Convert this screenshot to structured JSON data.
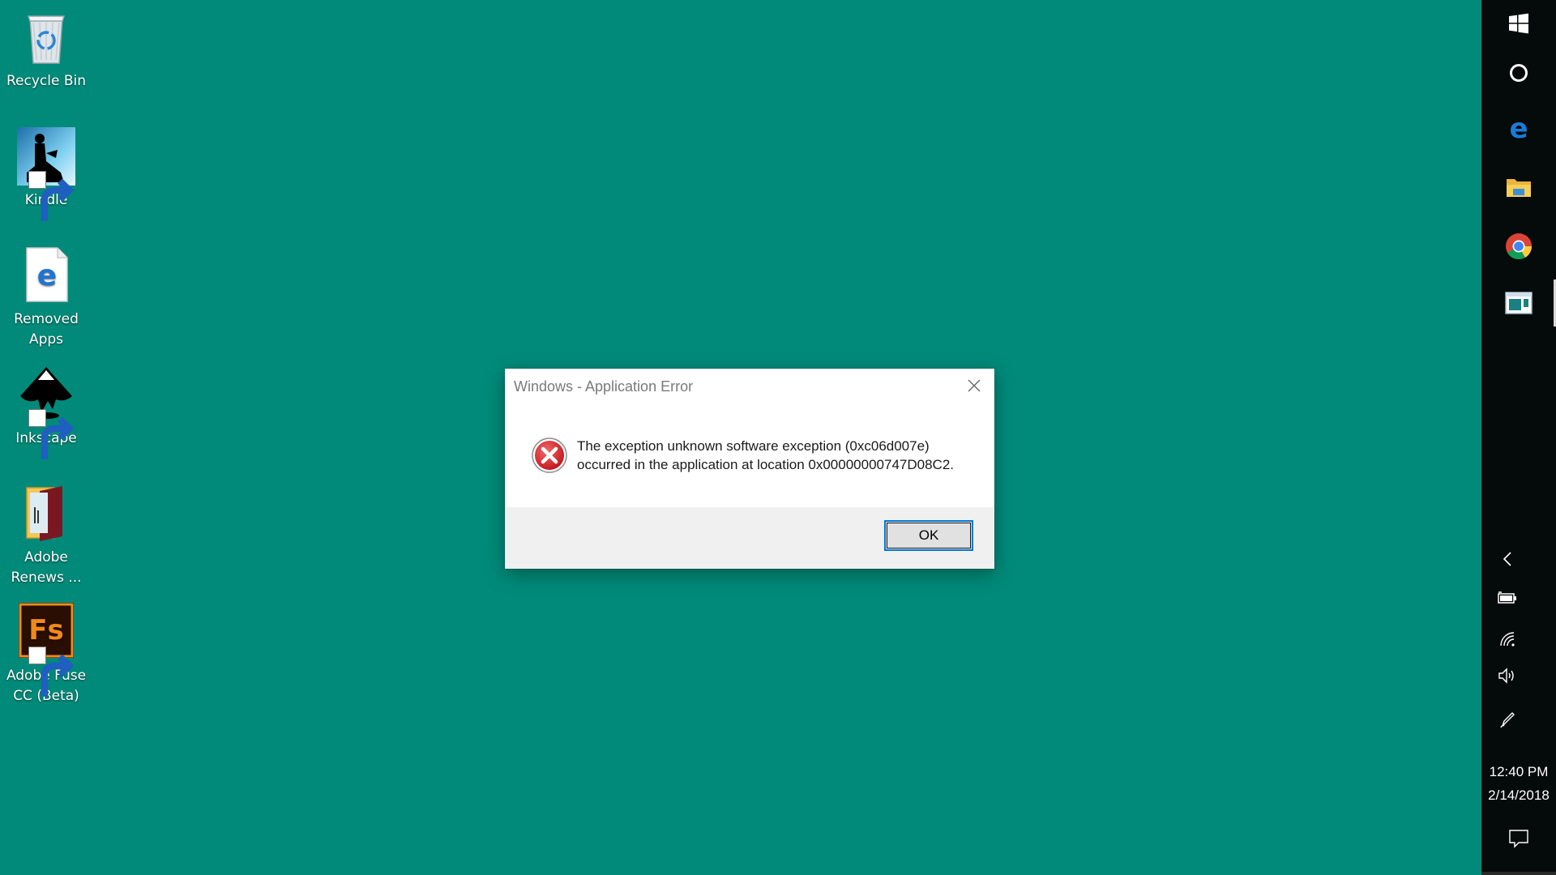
{
  "desktop": {
    "background_color": "#018a79",
    "icons": [
      {
        "id": "recycle-bin",
        "label": "Recycle Bin",
        "icon": "recycle-bin-icon",
        "shortcut": false
      },
      {
        "id": "kindle",
        "label": "Kindle",
        "icon": "kindle-icon",
        "shortcut": true
      },
      {
        "id": "removed-apps",
        "label": "Removed Apps",
        "icon": "edge-document-icon",
        "shortcut": false
      },
      {
        "id": "inkscape",
        "label": "Inkscape",
        "icon": "inkscape-icon",
        "shortcut": true
      },
      {
        "id": "adobe-renews",
        "label": "Adobe Renews ...",
        "icon": "folder-icon",
        "shortcut": false
      },
      {
        "id": "adobe-fuse",
        "label": "Adobe Fuse CC (Beta)",
        "icon": "adobe-fuse-icon",
        "shortcut": true
      }
    ]
  },
  "dialog": {
    "title": "Windows - Application Error",
    "message_line1": "The exception unknown software exception (0xc06d007e)",
    "message_line2": "occurred in the application at location 0x00000000747D08C2.",
    "ok_label": "OK",
    "icon": "error-icon"
  },
  "taskbar": {
    "background_color": "#050a0a",
    "pinned": [
      {
        "id": "start",
        "icon": "windows-start-icon"
      },
      {
        "id": "cortana",
        "icon": "cortana-circle-icon"
      },
      {
        "id": "edge",
        "icon": "edge-icon"
      },
      {
        "id": "file-explorer",
        "icon": "file-explorer-icon"
      },
      {
        "id": "chrome",
        "icon": "chrome-icon"
      },
      {
        "id": "app-window",
        "icon": "app-window-icon",
        "active": true
      }
    ],
    "tray": [
      {
        "id": "show-hidden",
        "icon": "chevron-left-icon"
      },
      {
        "id": "battery",
        "icon": "battery-icon"
      },
      {
        "id": "network",
        "icon": "wifi-icon"
      },
      {
        "id": "volume",
        "icon": "volume-icon"
      },
      {
        "id": "pen",
        "icon": "pen-icon"
      }
    ],
    "clock": {
      "time": "12:40 PM",
      "date": "2/14/2018"
    },
    "action_center_icon": "action-center-icon"
  }
}
